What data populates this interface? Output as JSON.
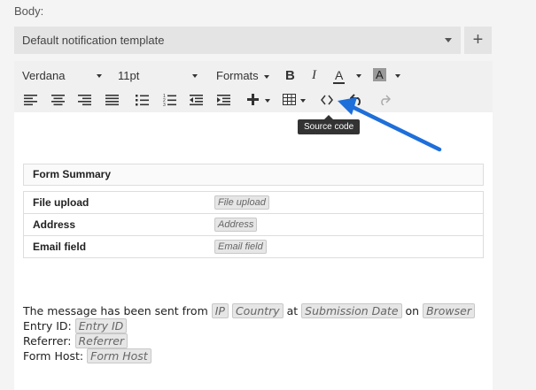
{
  "body_label": "Body:",
  "template_select": {
    "value": "Default notification template"
  },
  "plus_button_label": "+",
  "toolbar": {
    "font_family": "Verdana",
    "font_size": "11pt",
    "formats": "Formats",
    "bold": "B",
    "italic": "I",
    "text_color": "A",
    "bg_color": "A"
  },
  "tooltip": "Source code",
  "form_summary": {
    "title": "Form Summary",
    "rows": [
      {
        "label": "File upload",
        "tag": "File upload"
      },
      {
        "label": "Address",
        "tag": "Address"
      },
      {
        "label": "Email field",
        "tag": "Email field"
      }
    ]
  },
  "message": {
    "line1_prefix": "The message has been sent from",
    "ip": "IP",
    "country": "Country",
    "at": "at",
    "submission_date": "Submission Date",
    "on": "on",
    "browser": "Browser",
    "entry_label": "Entry ID:",
    "entry_tag": "Entry ID",
    "referrer_label": "Referrer:",
    "referrer_tag": "Referrer",
    "host_label": "Form Host:",
    "host_tag": "Form Host"
  },
  "colors": {
    "arrow": "#1e6fd9",
    "tooltip_bg": "#333333",
    "toolbar_bg": "#f0f0f0"
  }
}
